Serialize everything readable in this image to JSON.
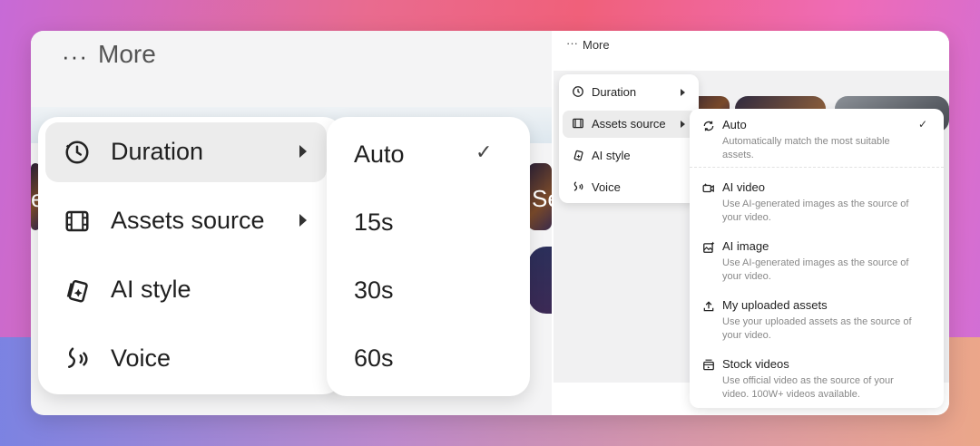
{
  "left": {
    "header": {
      "dots": "···",
      "title": "More"
    },
    "menu": [
      {
        "label": "Duration",
        "icon": "clock-icon",
        "submenu": true
      },
      {
        "label": "Assets source",
        "icon": "film-icon",
        "submenu": true
      },
      {
        "label": "AI style",
        "icon": "cards-icon",
        "submenu": false
      },
      {
        "label": "Voice",
        "icon": "voice-icon",
        "submenu": false
      }
    ],
    "duration_options": [
      "Auto",
      "15s",
      "30s",
      "60s"
    ],
    "selected": "Auto",
    "bg_fragments": [
      "e",
      "Se"
    ]
  },
  "right": {
    "header": {
      "dots": "···",
      "title": "More"
    },
    "menu": [
      {
        "label": "Duration",
        "icon": "clock-icon",
        "submenu": true
      },
      {
        "label": "Assets source",
        "icon": "film-icon",
        "submenu": true
      },
      {
        "label": "AI style",
        "icon": "cards-icon",
        "submenu": false
      },
      {
        "label": "Voice",
        "icon": "voice-icon",
        "submenu": false
      }
    ],
    "assets_options": [
      {
        "title": "Auto",
        "desc": "Automatically match the most suitable assets.",
        "icon": "auto-sync-icon"
      },
      {
        "title": "AI video",
        "desc": "Use AI-generated images as the source of your video.",
        "icon": "ai-video-icon"
      },
      {
        "title": "AI image",
        "desc": "Use AI-generated images as the source of your video.",
        "icon": "ai-image-icon"
      },
      {
        "title": "My uploaded assets",
        "desc": "Use your uploaded assets as the source of your video.",
        "icon": "upload-icon"
      },
      {
        "title": "Stock videos",
        "desc": "Use official video as the source of your video. 100W+ videos available.",
        "icon": "stock-video-icon"
      }
    ],
    "selected": "Auto"
  },
  "check_glyph": "✓",
  "colors": {
    "hover": "#ececec",
    "text": "#1f1f1f",
    "muted": "#888888"
  }
}
